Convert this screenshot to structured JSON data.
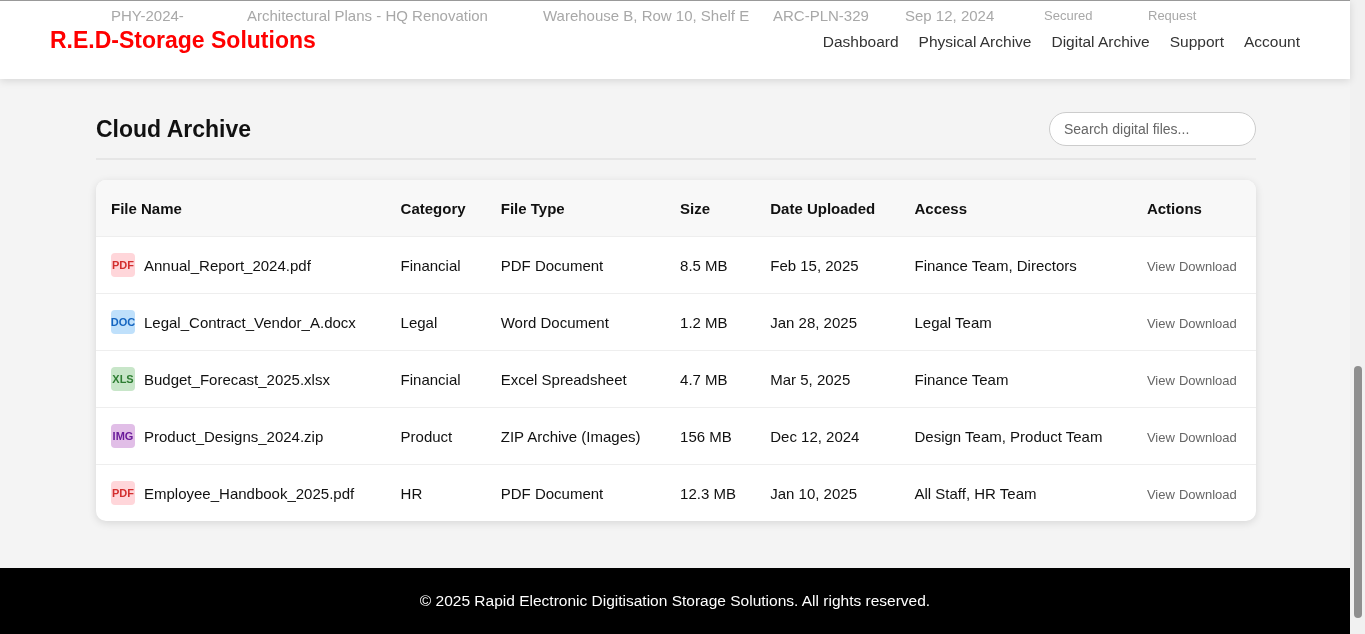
{
  "background_row": [
    "PHY-2024-",
    "Architectural Plans - HQ Renovation",
    "Warehouse B, Row 10, Shelf E",
    "ARC-PLN-329",
    "Sep 12, 2024",
    "Secured",
    "Request"
  ],
  "header": {
    "logo": "R.E.D-Storage Solutions",
    "nav": [
      "Dashboard",
      "Physical Archive",
      "Digital Archive",
      "Support",
      "Account"
    ]
  },
  "section": {
    "title": "Cloud Archive",
    "search": {
      "placeholder": "Search digital files..."
    }
  },
  "table": {
    "columns": [
      "File Name",
      "Category",
      "File Type",
      "Size",
      "Date Uploaded",
      "Access",
      "Actions"
    ],
    "rows": [
      {
        "kind": "pdf",
        "badge": "PDF",
        "name": "Annual_Report_2024.pdf",
        "category": "Financial",
        "type": "PDF Document",
        "size": "8.5 MB",
        "date": "Feb 15, 2025",
        "access": "Finance Team, Directors",
        "actions": [
          "View",
          "Download"
        ]
      },
      {
        "kind": "doc",
        "badge": "DOC",
        "name": "Legal_Contract_Vendor_A.docx",
        "category": "Legal",
        "type": "Word Document",
        "size": "1.2 MB",
        "date": "Jan 28, 2025",
        "access": "Legal Team",
        "actions": [
          "View",
          "Download"
        ]
      },
      {
        "kind": "xls",
        "badge": "XLS",
        "name": "Budget_Forecast_2025.xlsx",
        "category": "Financial",
        "type": "Excel Spreadsheet",
        "size": "4.7 MB",
        "date": "Mar 5, 2025",
        "access": "Finance Team",
        "actions": [
          "View",
          "Download"
        ]
      },
      {
        "kind": "img",
        "badge": "IMG",
        "name": "Product_Designs_2024.zip",
        "category": "Product",
        "type": "ZIP Archive (Images)",
        "size": "156 MB",
        "date": "Dec 12, 2024",
        "access": "Design Team, Product Team",
        "actions": [
          "View",
          "Download"
        ]
      },
      {
        "kind": "pdf",
        "badge": "PDF",
        "name": "Employee_Handbook_2025.pdf",
        "category": "HR",
        "type": "PDF Document",
        "size": "12.3 MB",
        "date": "Jan 10, 2025",
        "access": "All Staff, HR Team",
        "actions": [
          "View",
          "Download"
        ]
      }
    ]
  },
  "footer": {
    "text": "© 2025 Rapid Electronic Digitisation Storage Solutions. All rights reserved."
  }
}
